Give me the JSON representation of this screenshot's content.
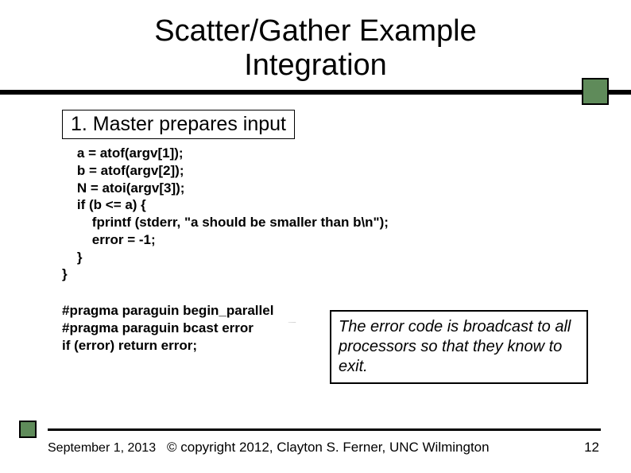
{
  "title_line1": "Scatter/Gather Example",
  "title_line2": "Integration",
  "step": "1.  Master prepares input",
  "code": "    a = atof(argv[1]);\n    b = atof(argv[2]);\n    N = atoi(argv[3]);\n    if (b <= a) {\n        fprintf (stderr, \"a should be smaller than b\\n\");\n        error = -1;\n    }\n}",
  "pragma": "#pragma paraguin begin_parallel\n#pragma paraguin bcast error\nif (error) return error;",
  "callout": "The error code is broadcast to all processors so that they know to exit.",
  "footer_date": "September 1, 2013",
  "footer_copy": "© copyright 2012, Clayton S. Ferner, UNC Wilmington",
  "page_num": "12"
}
